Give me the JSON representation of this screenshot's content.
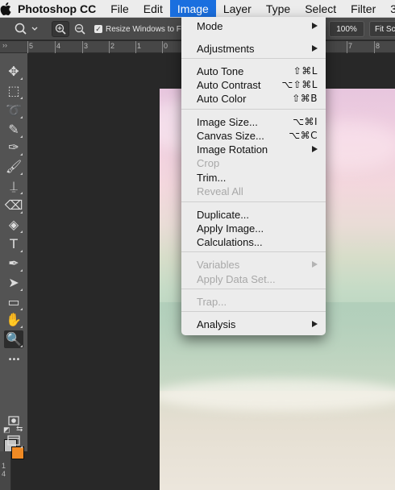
{
  "menubar": {
    "items": [
      {
        "label": "Photoshop CC"
      },
      {
        "label": "File"
      },
      {
        "label": "Edit"
      },
      {
        "label": "Image"
      },
      {
        "label": "Layer"
      },
      {
        "label": "Type"
      },
      {
        "label": "Select"
      },
      {
        "label": "Filter"
      },
      {
        "label": "3"
      }
    ],
    "active": "Image"
  },
  "options_bar": {
    "resize_windows_label": "Resize Windows to Fi",
    "resize_windows_checked": true,
    "zoom_percent": "100%",
    "fit_screen_label": "Fit Sc"
  },
  "ruler": {
    "labels": [
      "5",
      "4",
      "3",
      "2",
      "1",
      "0",
      "7",
      "8"
    ],
    "vertical_labels": [
      "1",
      "4"
    ]
  },
  "tools": [
    {
      "name": "move-tool",
      "glyph": "✥"
    },
    {
      "name": "marquee-tool",
      "glyph": "⬚"
    },
    {
      "name": "lasso-tool",
      "glyph": "➰"
    },
    {
      "name": "quick-selection-tool",
      "glyph": "✎"
    },
    {
      "name": "eyedropper-tool",
      "glyph": "✑"
    },
    {
      "name": "brush-tool",
      "glyph": "🖌"
    },
    {
      "name": "clone-stamp-tool",
      "glyph": "⍊"
    },
    {
      "name": "eraser-tool",
      "glyph": "⌫"
    },
    {
      "name": "paint-bucket-tool",
      "glyph": "◈"
    },
    {
      "name": "type-tool",
      "glyph": "T"
    },
    {
      "name": "pen-tool",
      "glyph": "✒"
    },
    {
      "name": "path-selection-tool",
      "glyph": "➤"
    },
    {
      "name": "rectangle-tool",
      "glyph": "▭"
    },
    {
      "name": "hand-tool",
      "glyph": "✋"
    },
    {
      "name": "zoom-tool",
      "glyph": "🔍",
      "selected": true
    },
    {
      "name": "more-tools",
      "glyph": "•••"
    }
  ],
  "colors": {
    "foreground": "#c5c5c5",
    "background": "#f08a24",
    "menu_highlight": "#1a6fdf"
  },
  "image_menu": {
    "sections": [
      [
        {
          "label": "Mode",
          "submenu": true
        },
        {
          "label": "Adjustments",
          "submenu": true
        }
      ],
      [
        {
          "label": "Auto Tone",
          "shortcut": "⇧⌘L"
        },
        {
          "label": "Auto Contrast",
          "shortcut": "⌥⇧⌘L"
        },
        {
          "label": "Auto Color",
          "shortcut": "⇧⌘B"
        }
      ],
      [
        {
          "label": "Image Size...",
          "shortcut": "⌥⌘I"
        },
        {
          "label": "Canvas Size...",
          "shortcut": "⌥⌘C"
        },
        {
          "label": "Image Rotation",
          "submenu": true
        },
        {
          "label": "Crop",
          "disabled": true
        },
        {
          "label": "Trim..."
        },
        {
          "label": "Reveal All",
          "disabled": true
        }
      ],
      [
        {
          "label": "Duplicate..."
        },
        {
          "label": "Apply Image..."
        },
        {
          "label": "Calculations..."
        }
      ],
      [
        {
          "label": "Variables",
          "submenu": true,
          "disabled": true
        },
        {
          "label": "Apply Data Set...",
          "disabled": true
        }
      ],
      [
        {
          "label": "Trap...",
          "disabled": true
        }
      ],
      [
        {
          "label": "Analysis",
          "submenu": true
        }
      ]
    ]
  }
}
